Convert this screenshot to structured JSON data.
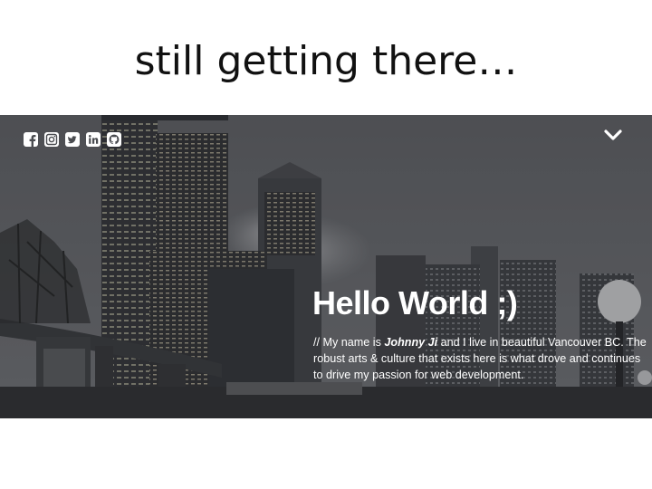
{
  "slide": {
    "title": "still getting there…"
  },
  "site": {
    "social_icons": [
      "facebook-icon",
      "instagram-icon",
      "twitter-icon",
      "linkedin-icon",
      "github-icon"
    ],
    "menu_icon": "chevron-down-icon",
    "hero": {
      "heading": "Hello World ;)",
      "intro_prefix": "// My name is ",
      "name": "Johnny Ji",
      "intro_suffix": " and I live in beautiful Vancouver BC. The robust arts & culture that exists here is what drove and continues to drive my passion for web development."
    }
  },
  "colors": {
    "text": "#ffffff",
    "photo_base": "#4a4c50"
  }
}
